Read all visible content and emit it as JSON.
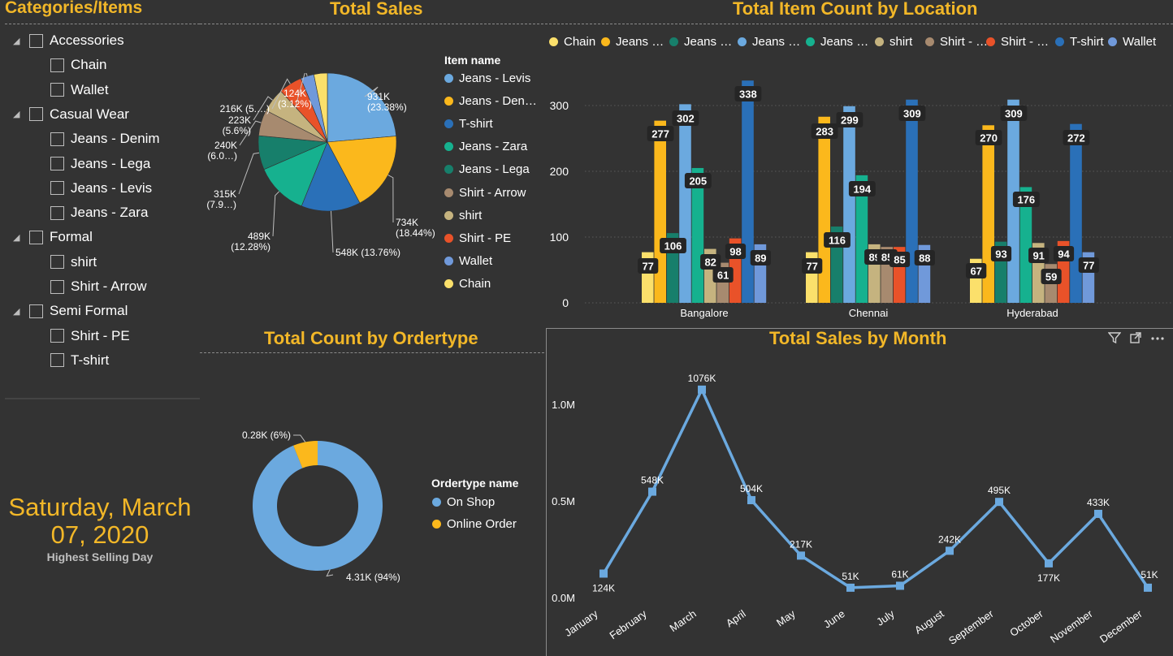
{
  "slicer": {
    "title": "Categories/Items",
    "groups": [
      {
        "label": "Accessories",
        "items": [
          "Chain",
          "Wallet"
        ]
      },
      {
        "label": "Casual Wear",
        "items": [
          "Jeans - Denim",
          "Jeans - Lega",
          "Jeans - Levis",
          "Jeans - Zara"
        ]
      },
      {
        "label": "Formal",
        "items": [
          "shirt",
          "Shirt - Arrow"
        ]
      },
      {
        "label": "Semi Formal",
        "items": [
          "Shirt - PE",
          "T-shirt"
        ]
      }
    ]
  },
  "card": {
    "date_line1": "Saturday, March",
    "date_line2": "07, 2020",
    "caption": "Highest Selling Day",
    "color": "#f2b728"
  },
  "colors": {
    "background": "#333333",
    "title": "#f2b728",
    "Chain": "#fbe06b",
    "Jeans - Denim": "#fbb81c",
    "Jeans - Lega": "#177f6b",
    "Jeans - Levis": "#6ba9df",
    "Jeans - Zara": "#16b18f",
    "shirt": "#c5b37f",
    "Shirt - Arrow": "#a78a6f",
    "Shirt - PE": "#e95229",
    "T-shirt": "#2a70b8",
    "Wallet": "#7099da"
  },
  "pie": {
    "title": "Total Sales",
    "legend_title": "Item name",
    "legend": [
      "Jeans - Levis",
      "Jeans - Den…",
      "T-shirt",
      "Jeans - Zara",
      "Jeans - Lega",
      "Shirt - Arrow",
      "shirt",
      "Shirt - PE",
      "Wallet",
      "Chain"
    ],
    "labels": [
      {
        "l1": "931K",
        "l2": "(23.38%)"
      },
      {
        "l1": "734K",
        "l2": "(18.44%)"
      },
      {
        "l1": "548K (13.76%)",
        "l2": ""
      },
      {
        "l1": "489K",
        "l2": "(12.28%)"
      },
      {
        "l1": "315K",
        "l2": "(7.9…)"
      },
      {
        "l1": "240K",
        "l2": "(6.0…)"
      },
      {
        "l1": "223K",
        "l2": "(5.6%)"
      },
      {
        "l1": "216K (5.…)",
        "l2": ""
      },
      {
        "l1": "124K",
        "l2": "(3.12%)"
      }
    ]
  },
  "bar": {
    "title": "Total Item Count by Location",
    "legend": [
      "Chain",
      "Jeans …",
      "Jeans …",
      "Jeans …",
      "Jeans …",
      "shirt",
      "Shirt - …",
      "Shirt - …",
      "T-shirt",
      "Wallet"
    ],
    "yticks": [
      "300",
      "200",
      "100",
      "0"
    ]
  },
  "donut": {
    "title": "Total Count by Ordertype",
    "legend_title": "Ordertype name",
    "legend": [
      "On Shop",
      "Online Order"
    ],
    "label_small": "0.28K (6%)",
    "label_big": "4.31K (94%)"
  },
  "line": {
    "title": "Total Sales by Month",
    "yticks": [
      "1.0M",
      "0.5M",
      "0.0M"
    ],
    "icons": [
      "filter-icon",
      "focus-mode-icon",
      "more-options-icon"
    ]
  },
  "chart_data": [
    {
      "type": "pie",
      "title": "Total Sales",
      "categories": [
        "Jeans - Levis",
        "Jeans - Denim",
        "T-shirt",
        "Jeans - Zara",
        "Jeans - Lega",
        "Shirt - Arrow",
        "shirt",
        "Shirt - PE",
        "Wallet",
        "Chain"
      ],
      "values": [
        931,
        734,
        548,
        489,
        315,
        240,
        223,
        216,
        124,
        124
      ],
      "unit": "K"
    },
    {
      "type": "bar",
      "title": "Total Item Count by Location",
      "categories": [
        "Bangalore",
        "Chennai",
        "Hyderabad"
      ],
      "ylim": [
        0,
        350
      ],
      "series": [
        {
          "name": "Chain",
          "values": [
            77,
            77,
            67
          ]
        },
        {
          "name": "Jeans - Denim",
          "values": [
            277,
            283,
            270
          ]
        },
        {
          "name": "Jeans - Lega",
          "values": [
            106,
            116,
            93
          ]
        },
        {
          "name": "Jeans - Levis",
          "values": [
            302,
            299,
            309
          ]
        },
        {
          "name": "Jeans - Zara",
          "values": [
            205,
            194,
            176
          ]
        },
        {
          "name": "shirt",
          "values": [
            82,
            89,
            91
          ]
        },
        {
          "name": "Shirt - Arrow",
          "values": [
            61,
            85,
            59
          ]
        },
        {
          "name": "Shirt - PE",
          "values": [
            98,
            85,
            94
          ]
        },
        {
          "name": "T-shirt",
          "values": [
            338,
            309,
            272
          ]
        },
        {
          "name": "Wallet",
          "values": [
            89,
            88,
            77
          ]
        }
      ]
    },
    {
      "type": "pie",
      "title": "Total Count by Ordertype",
      "categories": [
        "On Shop",
        "Online Order"
      ],
      "values": [
        4.31,
        0.28
      ],
      "unit": "K"
    },
    {
      "type": "line",
      "title": "Total Sales by Month",
      "categories": [
        "January",
        "February",
        "March",
        "April",
        "May",
        "June",
        "July",
        "August",
        "September",
        "October",
        "November",
        "December"
      ],
      "values": [
        124,
        548,
        1076,
        504,
        217,
        51,
        61,
        242,
        495,
        177,
        433,
        51
      ],
      "labels": [
        "124K",
        "548K",
        "1076K",
        "504K",
        "217K",
        "51K",
        "61K",
        "242K",
        "495K",
        "177K",
        "433K",
        "51K"
      ],
      "unit": "K",
      "ylim": [
        0,
        1200
      ]
    }
  ]
}
